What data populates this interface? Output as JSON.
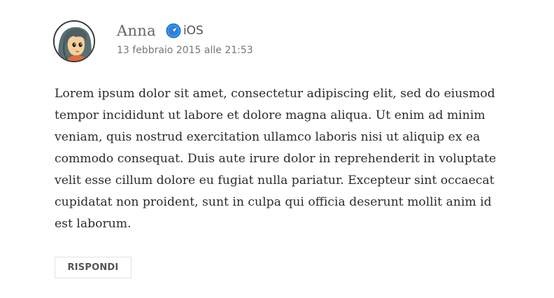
{
  "comment": {
    "author": {
      "name": "Anna",
      "avatar_icon": "girl-avatar-icon"
    },
    "platform": {
      "icon": "safari-compass-icon",
      "label": "iOS"
    },
    "date": "13 febbraio 2015 alle 21:53",
    "body": "Lorem ipsum dolor sit amet, consectetur adipiscing elit, sed do eiusmod tempor incididunt ut labore et dolore magna aliqua. Ut enim ad minim veniam, quis nostrud exercitation ullamco laboris nisi ut aliquip ex ea commodo consequat. Duis aute irure dolor in reprehenderit in voluptate velit esse cillum dolore eu fugiat nulla pariatur. Excepteur sint occaecat cupidatat non proident, sunt in culpa qui officia deserunt mollit anim id est laborum.",
    "reply_label": "RISPONDI"
  },
  "colors": {
    "text": "#2b2b2b",
    "meta": "#777777",
    "author": "#666666",
    "safari_blue": "#1e88e5",
    "button_border": "#e3e3e3"
  }
}
